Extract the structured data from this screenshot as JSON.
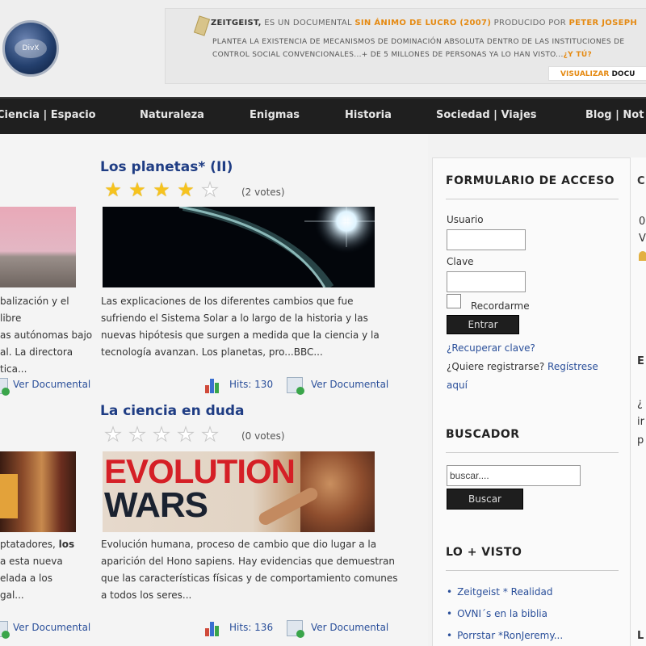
{
  "header": {
    "logo_text": "DivX",
    "promo": {
      "title": "ZEITGEIST,",
      "text1": " ES UN DOCUMENTAL ",
      "highlight1": "SIN ÁNIMO DE LUCRO (2007)",
      "text2": " PRODUCIDO POR ",
      "highlight2": "PETER JOSEPH",
      "line2": "PLANTEA LA EXISTENCIA DE MECANISMOS DE DOMINACIÓN ABSOLUTA DENTRO DE LAS INSTITUCIONES DE",
      "line3": "CONTROL SOCIAL CONVENCIONALES...+ DE 5 MILLONES DE PERSONAS YA LO HAN VISTO...",
      "line3_highlight": "¿Y TÚ?",
      "button_orange": "VISUALIZAR",
      "button_dark": "DOCU"
    }
  },
  "nav": {
    "items": [
      "Ciencia | Espacio",
      "Naturaleza",
      "Enigmas",
      "Historia",
      "Sociedad | Viajes",
      "Blog | Not"
    ]
  },
  "main": {
    "articles": [
      {
        "title": "Los planetas* (II)",
        "votes": "(2 votes)",
        "rating": 4,
        "description": "Las explicaciones de los diferentes cambios que fue sufriendo el Sistema Solar a lo largo de la historia y las nuevas hipótesis que surgen a medida que la ciencia y la tecnología avanzan. Los planetas, pro...BBC...",
        "hits": "Hits: 130",
        "link": "Ver Documental"
      },
      {
        "title": "La ciencia en duda",
        "votes": "(0 votes)",
        "rating": 0,
        "thumb_line1": "EVOLUTION",
        "thumb_line2": "WARS",
        "description": "Evolución humana, proceso de cambio que dio lugar a la aparición del Hono sapiens. Hay evidencias que demuestran que las características físicas y de comportamiento comunes a todos los seres...",
        "hits": "Hits: 136",
        "link": "Ver Documental"
      }
    ],
    "left_cut": {
      "desc1": [
        "balización y el libre",
        "as autónomas bajo",
        "al. La directora",
        "tica..."
      ],
      "link1": "Ver Documental",
      "desc2_a": "ptatadores, ",
      "desc2_b": "los",
      "desc2": [
        "a esta nueva",
        "elada a los",
        "gal..."
      ],
      "link2": "Ver Documental"
    }
  },
  "sidebar": {
    "login": {
      "heading": "FORMULARIO DE ACCESO",
      "user_label": "Usuario",
      "user_value": "",
      "pass_label": "Clave",
      "pass_value": "",
      "remember": "Recordarme",
      "submit": "Entrar",
      "recover": "¿Recuperar clave?",
      "register_q": "¿Quiere registrarse? ",
      "register_link": "Regístrese",
      "register_tail": "aquí"
    },
    "search": {
      "heading": "BUSCADOR",
      "value": "buscar....",
      "button": "Buscar"
    },
    "most_viewed": {
      "heading": "LO + VISTO",
      "items": [
        "Zeitgeist * Realidad",
        "OVNI´s en la biblia",
        "Porrstar *RonJeremy..."
      ]
    }
  },
  "right_cut": {
    "h1": "C",
    "t1": "0",
    "t2": "V",
    "h2": "E",
    "t3": "¿",
    "t4": "ir",
    "t5": "p",
    "h3": "L"
  },
  "colors": {
    "nav_bg": "#1f1f1f",
    "title_blue": "#1f3d84",
    "link_blue": "#2a4f9a",
    "accent_orange": "#e58a12",
    "star_yellow": "#f6c31e"
  }
}
